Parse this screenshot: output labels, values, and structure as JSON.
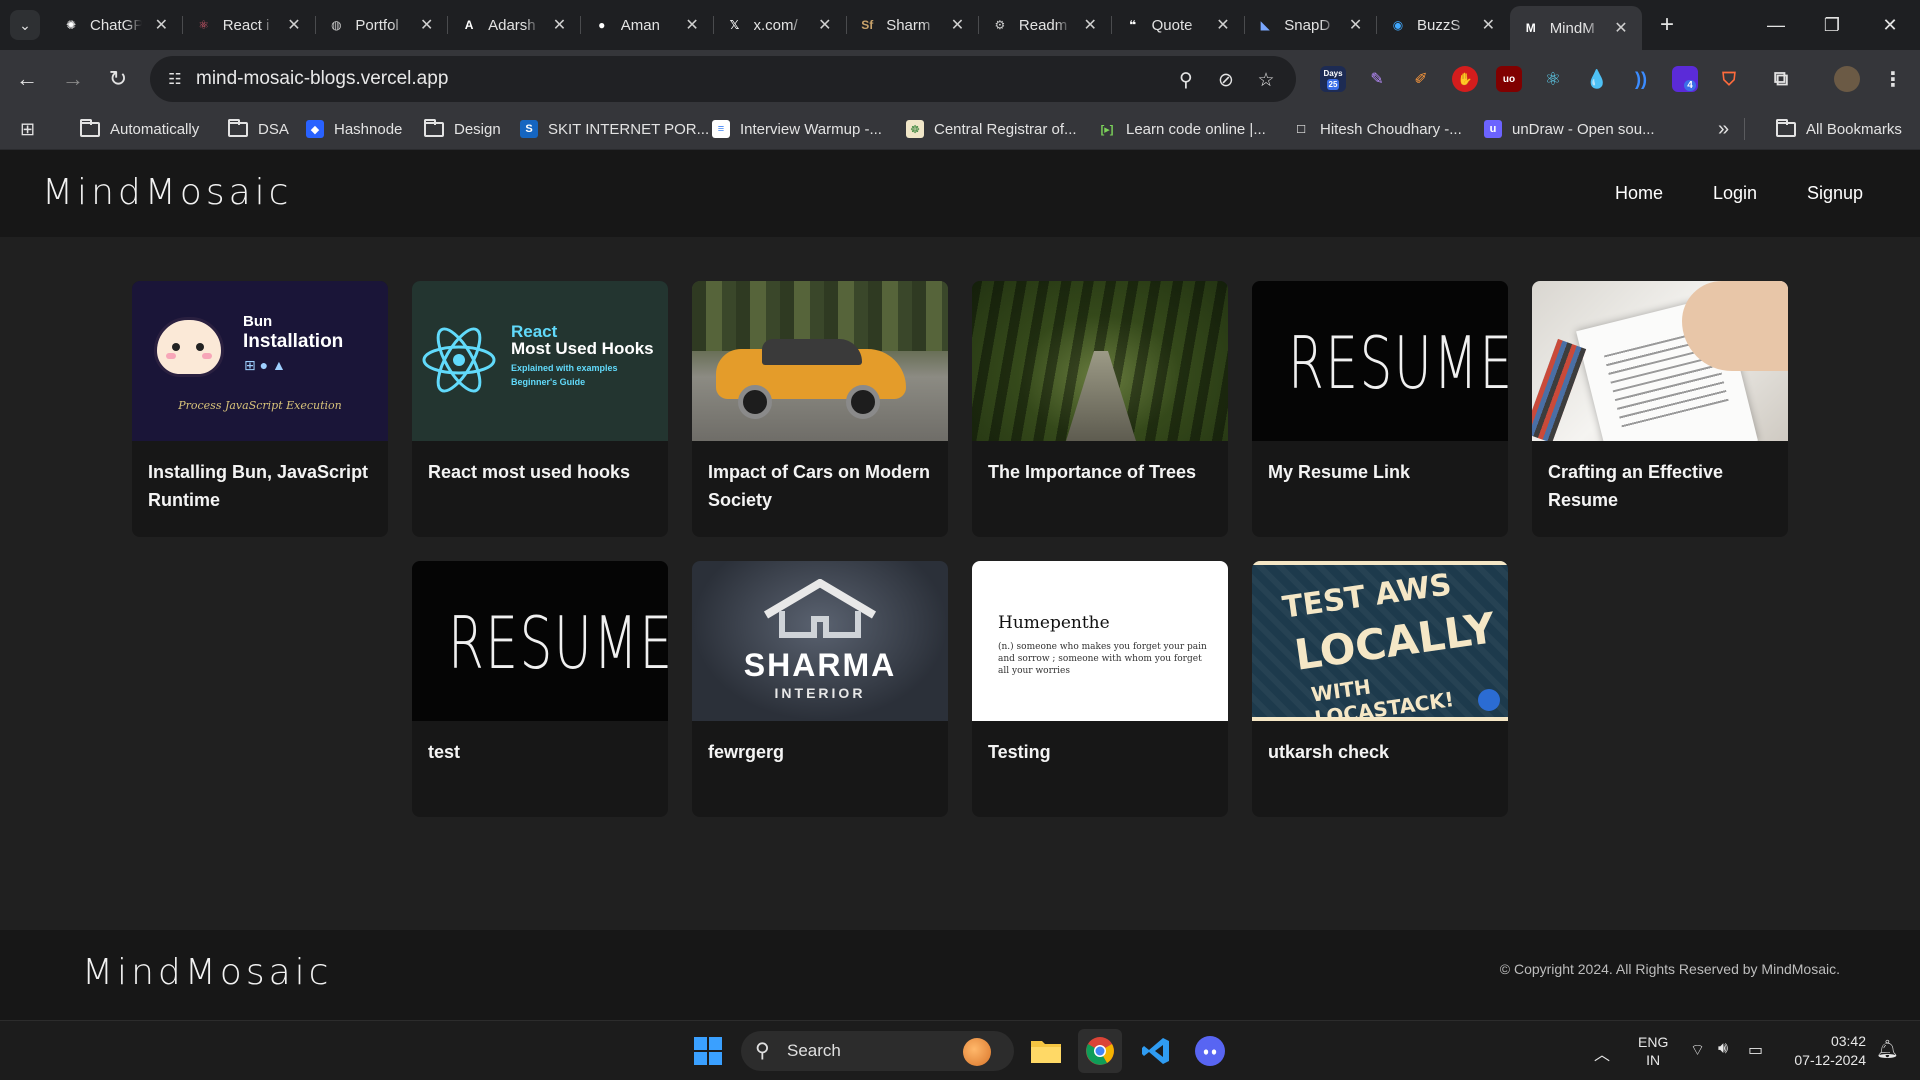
{
  "tabs": [
    {
      "title": "ChatGPT",
      "icon": "chatgpt-icon",
      "color": "#ffffff"
    },
    {
      "title": "React i",
      "icon": "react-icon",
      "color": "#e05d72"
    },
    {
      "title": "Portfol",
      "icon": "globe-icon",
      "color": "#cfcfcf"
    },
    {
      "title": "Adarsh",
      "icon": "a-letter-icon",
      "color": "#ffffff"
    },
    {
      "title": "Aman",
      "icon": "github-icon",
      "color": "#ffffff"
    },
    {
      "title": "x.com/",
      "icon": "x-icon",
      "color": "#ffffff"
    },
    {
      "title": "Sharm",
      "icon": "sharma-icon",
      "color": "#c9a36b"
    },
    {
      "title": "Readm",
      "icon": "readme-icon",
      "color": "#cfcfcf"
    },
    {
      "title": "Quote",
      "icon": "discord-quote-icon",
      "color": "#ffffff"
    },
    {
      "title": "SnapD",
      "icon": "snap-icon",
      "color": "#7aa7ff"
    },
    {
      "title": "BuzzS",
      "icon": "buzz-icon",
      "color": "#41a9ff"
    },
    {
      "title": "MindM",
      "icon": "mindmosaic-tab-icon",
      "color": "#ffffff",
      "active": true
    }
  ],
  "browser": {
    "url": "mind-mosaic-blogs.vercel.app",
    "days_ext": {
      "top": "Days",
      "bottom": "25"
    },
    "ext_badge": "4"
  },
  "bookmarks": [
    {
      "label": "Automatically",
      "icon": "folder-icon"
    },
    {
      "label": "DSA",
      "icon": "folder-icon"
    },
    {
      "label": "Hashnode",
      "icon": "hashnode-icon"
    },
    {
      "label": "Design",
      "icon": "folder-icon"
    },
    {
      "label": "SKIT INTERNET POR...",
      "icon": "skit-icon"
    },
    {
      "label": "Interview Warmup -...",
      "icon": "google-icon"
    },
    {
      "label": "Central Registrar of...",
      "icon": "emblem-icon"
    },
    {
      "label": "Learn code online |...",
      "icon": "code-icon"
    },
    {
      "label": "Hitesh Choudhary -...",
      "icon": "square-icon"
    },
    {
      "label": "unDraw - Open sou...",
      "icon": "undraw-icon"
    }
  ],
  "all_bookmarks": "All Bookmarks",
  "site": {
    "logo": "MindMosaic",
    "nav": [
      "Home",
      "Login",
      "Signup"
    ],
    "copyright": "© Copyright 2024. All Rights Reserved by MindMosaic."
  },
  "posts": [
    {
      "title": "Installing Bun, JavaScript Runtime",
      "thumb": "bun",
      "thumb_text": [
        "Bun",
        "Installation",
        "Process JavaScript Execution"
      ]
    },
    {
      "title": "React most used hooks",
      "thumb": "react",
      "thumb_text": [
        "React",
        "Most Used Hooks",
        "Explained with examples",
        "Beginner's Guide"
      ]
    },
    {
      "title": "Impact of Cars on Modern Society",
      "thumb": "car",
      "thumb_text": []
    },
    {
      "title": "The Importance of Trees",
      "thumb": "forest",
      "thumb_text": []
    },
    {
      "title": "My Resume Link",
      "thumb": "resume",
      "thumb_text": [
        "RESUME"
      ]
    },
    {
      "title": "Crafting an Effective Resume",
      "thumb": "paper",
      "thumb_text": []
    },
    {
      "title": "test",
      "thumb": "resume",
      "thumb_text": [
        "RESUME"
      ]
    },
    {
      "title": "fewrgerg",
      "thumb": "sharma",
      "thumb_text": [
        "SHARMA",
        "INTERIOR"
      ]
    },
    {
      "title": "Testing",
      "thumb": "humepenthe",
      "thumb_text": [
        "Humepenthe",
        "(n.) someone who makes you forget your pain and sorrow ; someone with whom you forget all your worries"
      ]
    },
    {
      "title": "utkarsh check",
      "thumb": "aws",
      "thumb_text": [
        "TEST AWS",
        "LOCALLY",
        "WITH LOCASTACK!"
      ]
    }
  ],
  "taskbar": {
    "search": "Search",
    "lang": [
      "ENG",
      "IN"
    ],
    "time": "03:42",
    "date": "07-12-2024"
  },
  "colors": {
    "page_bg": "#202020",
    "header_bg": "#171717",
    "card_bg": "#171717"
  }
}
